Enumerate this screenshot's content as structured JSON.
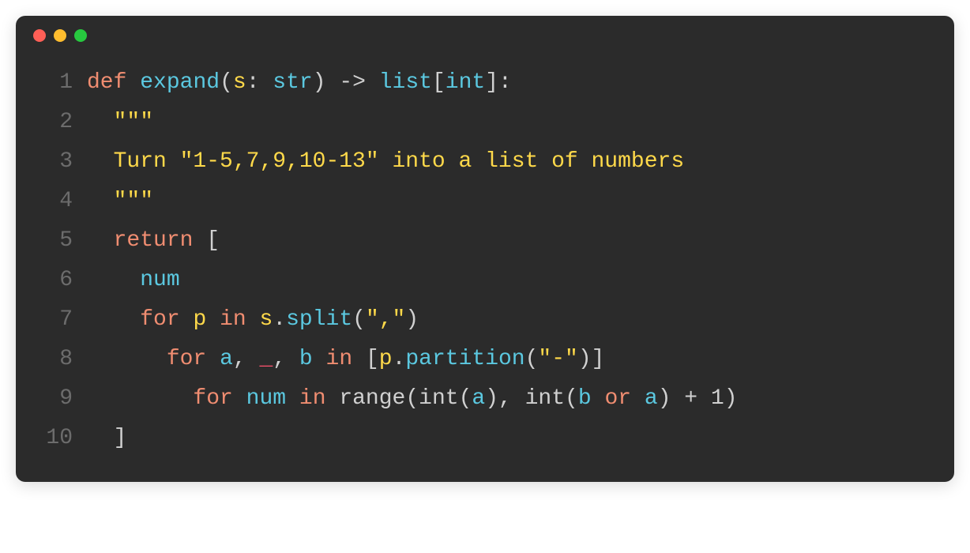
{
  "window": {
    "traffic_lights": [
      "red",
      "yellow",
      "green"
    ]
  },
  "code": {
    "lines": [
      {
        "num": "1",
        "tokens": [
          {
            "cls": "tok-keyword",
            "t": "def"
          },
          {
            "cls": "tok-default",
            "t": " "
          },
          {
            "cls": "tok-func",
            "t": "expand"
          },
          {
            "cls": "tok-punct",
            "t": "("
          },
          {
            "cls": "tok-param",
            "t": "s"
          },
          {
            "cls": "tok-punct",
            "t": ": "
          },
          {
            "cls": "tok-type",
            "t": "str"
          },
          {
            "cls": "tok-punct",
            "t": ") "
          },
          {
            "cls": "tok-arrow",
            "t": "->"
          },
          {
            "cls": "tok-default",
            "t": " "
          },
          {
            "cls": "tok-type",
            "t": "list"
          },
          {
            "cls": "tok-punct",
            "t": "["
          },
          {
            "cls": "tok-type",
            "t": "int"
          },
          {
            "cls": "tok-punct",
            "t": "]:"
          }
        ]
      },
      {
        "num": "2",
        "tokens": [
          {
            "cls": "tok-default",
            "t": "  "
          },
          {
            "cls": "tok-string",
            "t": "\"\"\""
          }
        ]
      },
      {
        "num": "3",
        "tokens": [
          {
            "cls": "tok-default",
            "t": "  "
          },
          {
            "cls": "tok-string",
            "t": "Turn \"1-5,7,9,10-13\" into a list of numbers"
          }
        ]
      },
      {
        "num": "4",
        "tokens": [
          {
            "cls": "tok-default",
            "t": "  "
          },
          {
            "cls": "tok-string",
            "t": "\"\"\""
          }
        ]
      },
      {
        "num": "5",
        "tokens": [
          {
            "cls": "tok-default",
            "t": "  "
          },
          {
            "cls": "tok-keyword",
            "t": "return"
          },
          {
            "cls": "tok-default",
            "t": " ["
          }
        ]
      },
      {
        "num": "6",
        "tokens": [
          {
            "cls": "tok-default",
            "t": "    "
          },
          {
            "cls": "tok-var-num",
            "t": "num"
          }
        ]
      },
      {
        "num": "7",
        "tokens": [
          {
            "cls": "tok-default",
            "t": "    "
          },
          {
            "cls": "tok-keyword",
            "t": "for"
          },
          {
            "cls": "tok-default",
            "t": " "
          },
          {
            "cls": "tok-var-p",
            "t": "p"
          },
          {
            "cls": "tok-default",
            "t": " "
          },
          {
            "cls": "tok-keyword",
            "t": "in"
          },
          {
            "cls": "tok-default",
            "t": " "
          },
          {
            "cls": "tok-var-s",
            "t": "s"
          },
          {
            "cls": "tok-punct",
            "t": "."
          },
          {
            "cls": "tok-func",
            "t": "split"
          },
          {
            "cls": "tok-punct",
            "t": "("
          },
          {
            "cls": "tok-string",
            "t": "\",\""
          },
          {
            "cls": "tok-punct",
            "t": ")"
          }
        ]
      },
      {
        "num": "8",
        "tokens": [
          {
            "cls": "tok-default",
            "t": "      "
          },
          {
            "cls": "tok-keyword",
            "t": "for"
          },
          {
            "cls": "tok-default",
            "t": " "
          },
          {
            "cls": "tok-var-a",
            "t": "a"
          },
          {
            "cls": "tok-punct",
            "t": ", "
          },
          {
            "cls": "tok-underscore",
            "t": "_"
          },
          {
            "cls": "tok-punct",
            "t": ", "
          },
          {
            "cls": "tok-var-b",
            "t": "b"
          },
          {
            "cls": "tok-default",
            "t": " "
          },
          {
            "cls": "tok-keyword",
            "t": "in"
          },
          {
            "cls": "tok-default",
            "t": " ["
          },
          {
            "cls": "tok-var-p",
            "t": "p"
          },
          {
            "cls": "tok-punct",
            "t": "."
          },
          {
            "cls": "tok-func",
            "t": "partition"
          },
          {
            "cls": "tok-punct",
            "t": "("
          },
          {
            "cls": "tok-string",
            "t": "\"-\""
          },
          {
            "cls": "tok-punct",
            "t": ")]"
          }
        ]
      },
      {
        "num": "9",
        "tokens": [
          {
            "cls": "tok-default",
            "t": "        "
          },
          {
            "cls": "tok-keyword",
            "t": "for"
          },
          {
            "cls": "tok-default",
            "t": " "
          },
          {
            "cls": "tok-var-num",
            "t": "num"
          },
          {
            "cls": "tok-default",
            "t": " "
          },
          {
            "cls": "tok-keyword",
            "t": "in"
          },
          {
            "cls": "tok-default",
            "t": " "
          },
          {
            "cls": "tok-builtin",
            "t": "range"
          },
          {
            "cls": "tok-punct",
            "t": "("
          },
          {
            "cls": "tok-builtin",
            "t": "int"
          },
          {
            "cls": "tok-punct",
            "t": "("
          },
          {
            "cls": "tok-var-a",
            "t": "a"
          },
          {
            "cls": "tok-punct",
            "t": "), "
          },
          {
            "cls": "tok-builtin",
            "t": "int"
          },
          {
            "cls": "tok-punct",
            "t": "("
          },
          {
            "cls": "tok-var-b",
            "t": "b"
          },
          {
            "cls": "tok-default",
            "t": " "
          },
          {
            "cls": "tok-keyword",
            "t": "or"
          },
          {
            "cls": "tok-default",
            "t": " "
          },
          {
            "cls": "tok-var-a",
            "t": "a"
          },
          {
            "cls": "tok-punct",
            "t": ") + "
          },
          {
            "cls": "tok-number",
            "t": "1"
          },
          {
            "cls": "tok-punct",
            "t": ")"
          }
        ]
      },
      {
        "num": "10",
        "tokens": [
          {
            "cls": "tok-default",
            "t": "  ]"
          }
        ]
      }
    ]
  }
}
